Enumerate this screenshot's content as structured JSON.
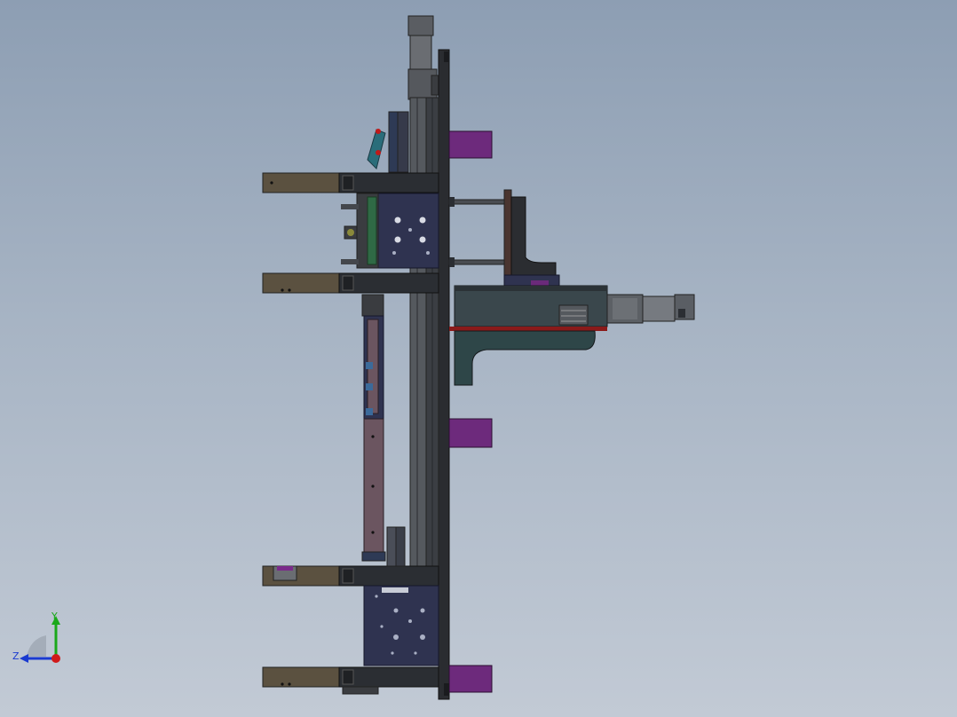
{
  "viewport": {
    "background_top": "#8d9eb3",
    "background_bottom": "#c2cad5"
  },
  "triad": {
    "y_label": "Y",
    "z_label": "Z",
    "x_color": "#d01a1a",
    "y_color": "#1aa81a",
    "z_color": "#1a3ad0"
  },
  "palette": {
    "frame_dark": "#2b2e33",
    "bracket_brown": "#5b5140",
    "purple_block": "#6a2a7a",
    "plate_navy": "#2f3350",
    "rod_mauve": "#6b5560",
    "motor_grey": "#5c6065",
    "housing_teal": "#3a474c",
    "accent_red": "#8a1a1a",
    "green_part": "#2f6a45"
  }
}
